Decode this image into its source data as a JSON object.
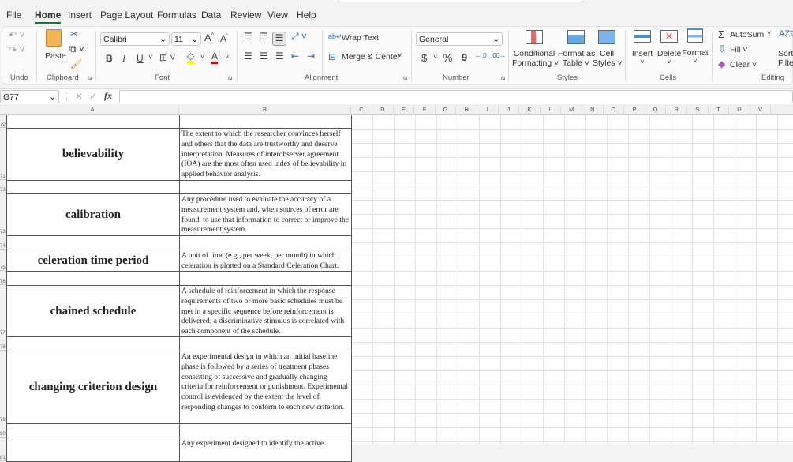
{
  "menu": {
    "tabs": [
      "File",
      "Home",
      "Insert",
      "Page Layout",
      "Formulas",
      "Data",
      "Review",
      "View",
      "Help"
    ],
    "active": "Home"
  },
  "ribbon": {
    "groups": {
      "undo": "Undo",
      "clipboard": "Clipboard",
      "font": "Font",
      "alignment": "Alignment",
      "number": "Number",
      "styles": "Styles",
      "cells": "Cells",
      "editing": "Editing"
    },
    "paste": "Paste",
    "font_name": "Calibri",
    "font_size": "11",
    "bold": "B",
    "italic": "I",
    "underline": "U",
    "wrap_text": "Wrap Text",
    "merge_center": "Merge & Center",
    "number_format": "General",
    "currency": "$",
    "percent": "%",
    "comma": "9",
    "conditional_formatting": [
      "Conditional",
      "Formatting"
    ],
    "format_as_table": [
      "Format as",
      "Table"
    ],
    "cell_styles": [
      "Cell",
      "Styles"
    ],
    "insert": "Insert",
    "delete": "Delete",
    "format": "Format",
    "autosum": "AutoSum",
    "fill": "Fill",
    "clear": "Clear",
    "sort_filter": [
      "Sort &",
      "Filter"
    ],
    "colors": {
      "fill_color": "#ffff00",
      "font_color": "#e00000",
      "accent": "#1e7145"
    }
  },
  "formula_bar": {
    "name_box": "G77",
    "formula": ""
  },
  "columns": [
    "A",
    "B",
    "C",
    "D",
    "E",
    "F",
    "G",
    "H",
    "I",
    "J",
    "K",
    "L",
    "M",
    "N",
    "O",
    "P",
    "Q",
    "R",
    "S",
    "T",
    "U",
    "V"
  ],
  "rows": [
    {
      "num": "70",
      "term": "",
      "def": ""
    },
    {
      "num": "71",
      "term": "believability",
      "def": "The extent to which the researcher convinces herself and others that the data are trustworthy and deserve interpretation. Measures of interobserver agreement (IOA) are the most often used index of believability in applied behavior analysis."
    },
    {
      "num": "72",
      "term": "",
      "def": ""
    },
    {
      "num": "73",
      "term": "calibration",
      "def": "Any procedure used to evaluate the accuracy of a measurement system and, when sources of error are found, to use that information to correct or improve the measurement system."
    },
    {
      "num": "74",
      "term": "",
      "def": ""
    },
    {
      "num": "75",
      "term": "celeration time period",
      "def": "A unit of time (e.g., per week, per month) in which celeration is plotted on a Standard Celeration Chart."
    },
    {
      "num": "76",
      "term": "",
      "def": ""
    },
    {
      "num": "77",
      "term": "chained schedule",
      "def": "A schedule of reinforcement in which the response requirements of two or more basic schedules must be met in a specific sequence before reinforcement is delivered; a discriminative stimulus is correlated with each component of the schedule."
    },
    {
      "num": "78",
      "term": "",
      "def": ""
    },
    {
      "num": "79",
      "term": "changing criterion design",
      "def": "An experimental design in which an initial baseline phase is followed by a series of treatment phases consisting of successive and gradually changing criteria for reinforcement or punishment. Experimental control is evidenced by the extent the level of responding changes to conform to each new criterion."
    },
    {
      "num": "80",
      "term": "",
      "def": ""
    },
    {
      "num": "81",
      "term": "",
      "def": "Any experiment designed to identify the active"
    }
  ]
}
